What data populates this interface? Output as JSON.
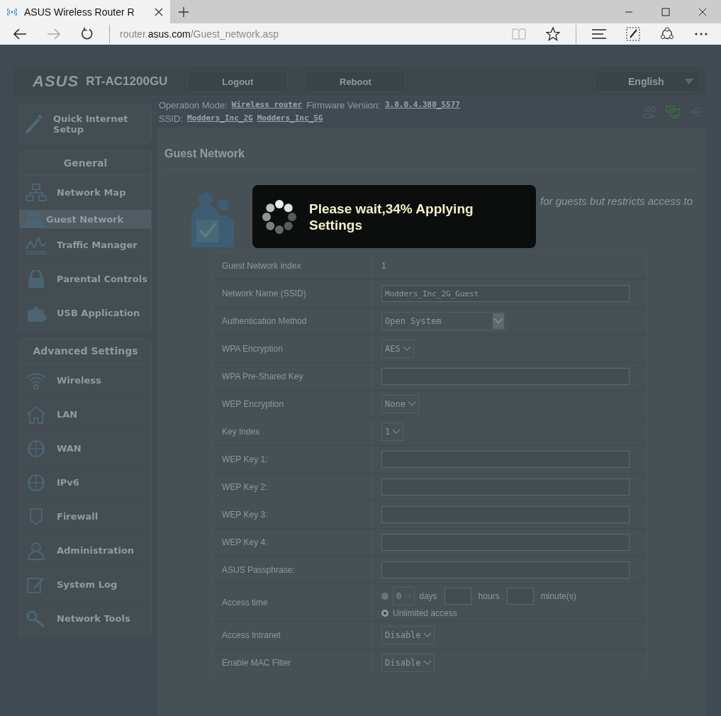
{
  "browser": {
    "tab_title": "ASUS Wireless Router R",
    "url": [
      {
        "text": "router.",
        "emphasis": false
      },
      {
        "text": "asus.com",
        "emphasis": true
      },
      {
        "text": "/Guest_network.asp",
        "emphasis": false
      }
    ]
  },
  "header": {
    "logo": "ASUS",
    "model": "RT-AC1200GU",
    "buttons": [
      "Logout",
      "Reboot"
    ],
    "language": "English"
  },
  "status": {
    "mode_label": "Operation Mode:",
    "mode": "Wireless router",
    "firmware_label": "Firmware Version:",
    "firmware": "3.0.0.4.380_5577",
    "ssid_label": "SSID:",
    "ssids": [
      "Modders_Inc_2G",
      "Modders_Inc_5G"
    ]
  },
  "sidebar": {
    "quick_setup": "Quick Internet Setup",
    "sections": [
      {
        "title": "General",
        "items": [
          {
            "label": "Network Map",
            "selected": false
          },
          {
            "label": "Guest Network",
            "selected": true
          },
          {
            "label": "Traffic Manager",
            "selected": false
          },
          {
            "label": "Parental Controls",
            "selected": false
          },
          {
            "label": "USB Application",
            "selected": false
          }
        ]
      },
      {
        "title": "Advanced Settings",
        "items": [
          {
            "label": "Wireless",
            "selected": false
          },
          {
            "label": "LAN",
            "selected": false
          },
          {
            "label": "WAN",
            "selected": false
          },
          {
            "label": "IPv6",
            "selected": false
          },
          {
            "label": "Firewall",
            "selected": false
          },
          {
            "label": "Administration",
            "selected": false
          },
          {
            "label": "System Log",
            "selected": false
          },
          {
            "label": "Network Tools",
            "selected": false
          }
        ]
      }
    ]
  },
  "page": {
    "title": "Guest Network",
    "description": "for guests but restricts access to"
  },
  "form": [
    {
      "kind": "text",
      "label": "Guest Network index",
      "value": "1"
    },
    {
      "kind": "input",
      "label": "Network Name (SSID)",
      "value": "Modders_Inc_2G_Guest"
    },
    {
      "kind": "dropdown",
      "label": "Authentication Method",
      "value": "Open System"
    },
    {
      "kind": "select",
      "label": "WPA Encryption",
      "value": "AES"
    },
    {
      "kind": "input",
      "label": "WPA Pre-Shared Key"
    },
    {
      "kind": "select",
      "label": "WEP Encryption",
      "value": "None"
    },
    {
      "kind": "select",
      "label": "Key Index",
      "value": "1"
    },
    {
      "kind": "input",
      "label": "WEP Key 1:"
    },
    {
      "kind": "input",
      "label": "WEP Key 2:"
    },
    {
      "kind": "input",
      "label": "WEP Key 3:"
    },
    {
      "kind": "input",
      "label": "WEP Key 4:"
    },
    {
      "kind": "input",
      "label": "ASUS Passphrase:"
    },
    {
      "kind": "access",
      "label": "Access time",
      "limited_checked": false,
      "days": "0",
      "days_label": "days",
      "hours_label": "hours",
      "minutes_label": "minute(s)",
      "unlimited_label": "Unlimited access",
      "unlimited_checked": true
    },
    {
      "kind": "select",
      "label": "Access Intranet",
      "value": "Disable"
    },
    {
      "kind": "select",
      "label": "Enable MAC Filter",
      "value": "Disable"
    }
  ],
  "overlay": {
    "message": "Please wait,34% Applying Settings"
  }
}
